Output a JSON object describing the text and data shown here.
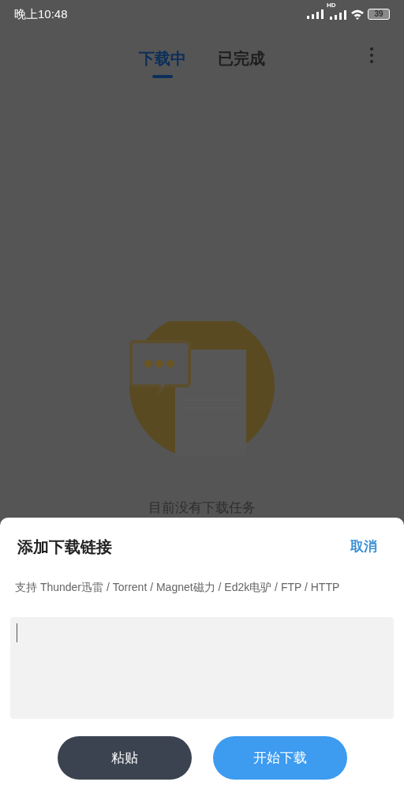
{
  "status_bar": {
    "time": "晚上10:48",
    "network_label": "HD",
    "battery": "39"
  },
  "tabs": [
    {
      "label": "下载中",
      "selected": true
    },
    {
      "label": "已完成",
      "selected": false
    }
  ],
  "empty_state": {
    "message": "目前没有下载任务"
  },
  "dialog": {
    "title": "添加下载链接",
    "cancel": "取消",
    "hint": "支持 Thunder迅雷 / Torrent / Magnet磁力 / Ed2k电驴 / FTP / HTTP",
    "buttons": [
      {
        "label": "粘贴",
        "kind": "secondary"
      },
      {
        "label": "开始下载",
        "kind": "primary"
      }
    ]
  }
}
